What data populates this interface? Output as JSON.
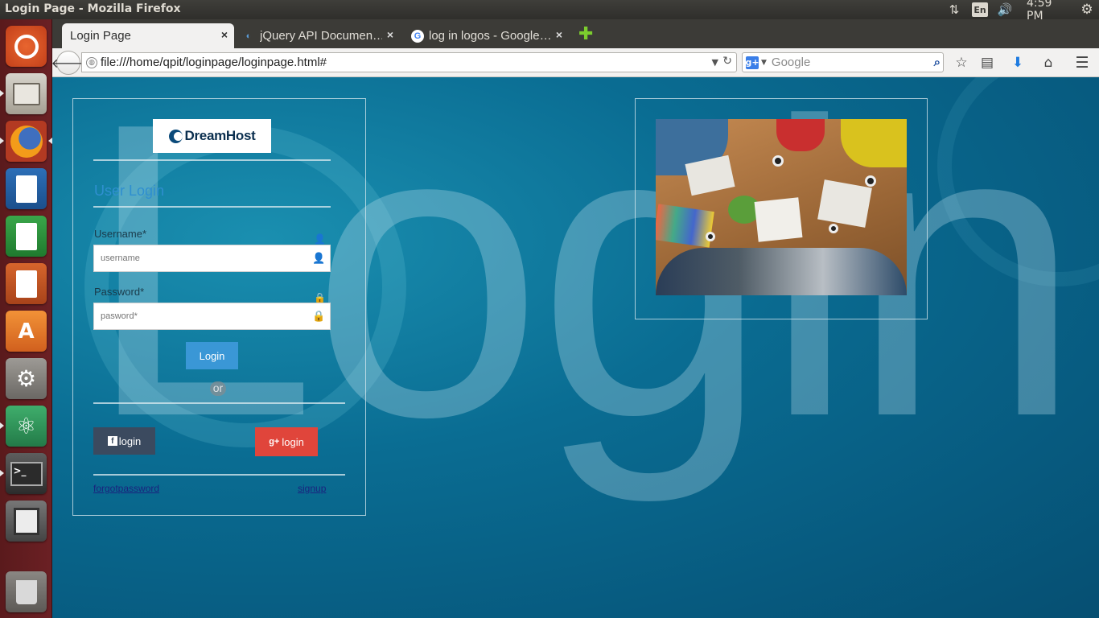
{
  "os": {
    "window_title": "Login Page - Mozilla Firefox",
    "language_indicator": "En",
    "clock": "4:59 PM",
    "launcher_apps": [
      "ubuntu-dash",
      "files",
      "firefox",
      "libreoffice-writer",
      "libreoffice-calc",
      "libreoffice-impress",
      "ubuntu-software-center",
      "system-settings",
      "atom-editor",
      "terminal",
      "save-disk",
      "trash"
    ]
  },
  "browser": {
    "tabs": [
      {
        "title": "Login Page",
        "active": true
      },
      {
        "title": "jQuery API Documen…",
        "active": false
      },
      {
        "title": "log in logos - Google…",
        "active": false
      }
    ],
    "tab_close_glyph": "×",
    "new_tab_glyph": "✚",
    "url": "file:///home/qpit/loginpage/loginpage.html#",
    "search_engine_label": "g+",
    "search_placeholder": "Google"
  },
  "page": {
    "background_word": "Login",
    "logo_text": "DreamHost",
    "heading": "User Login",
    "username_label": "Username*",
    "username_placeholder": "username",
    "password_label": "Password*",
    "password_placeholder": "pasword*",
    "login_button": "Login",
    "or_text": "or",
    "facebook_button": "login",
    "facebook_icon": "f",
    "google_button": "login",
    "google_icon": "g+",
    "forgot_link": "forgotpassword",
    "signup_link": "signup"
  },
  "colors": {
    "page_background": "#0a6d93",
    "heading": "#2f8fd0",
    "login_button": "#3a97d6",
    "facebook_button": "#3b4a5f",
    "google_button": "#e0453b",
    "launcher": "#6b2024"
  }
}
